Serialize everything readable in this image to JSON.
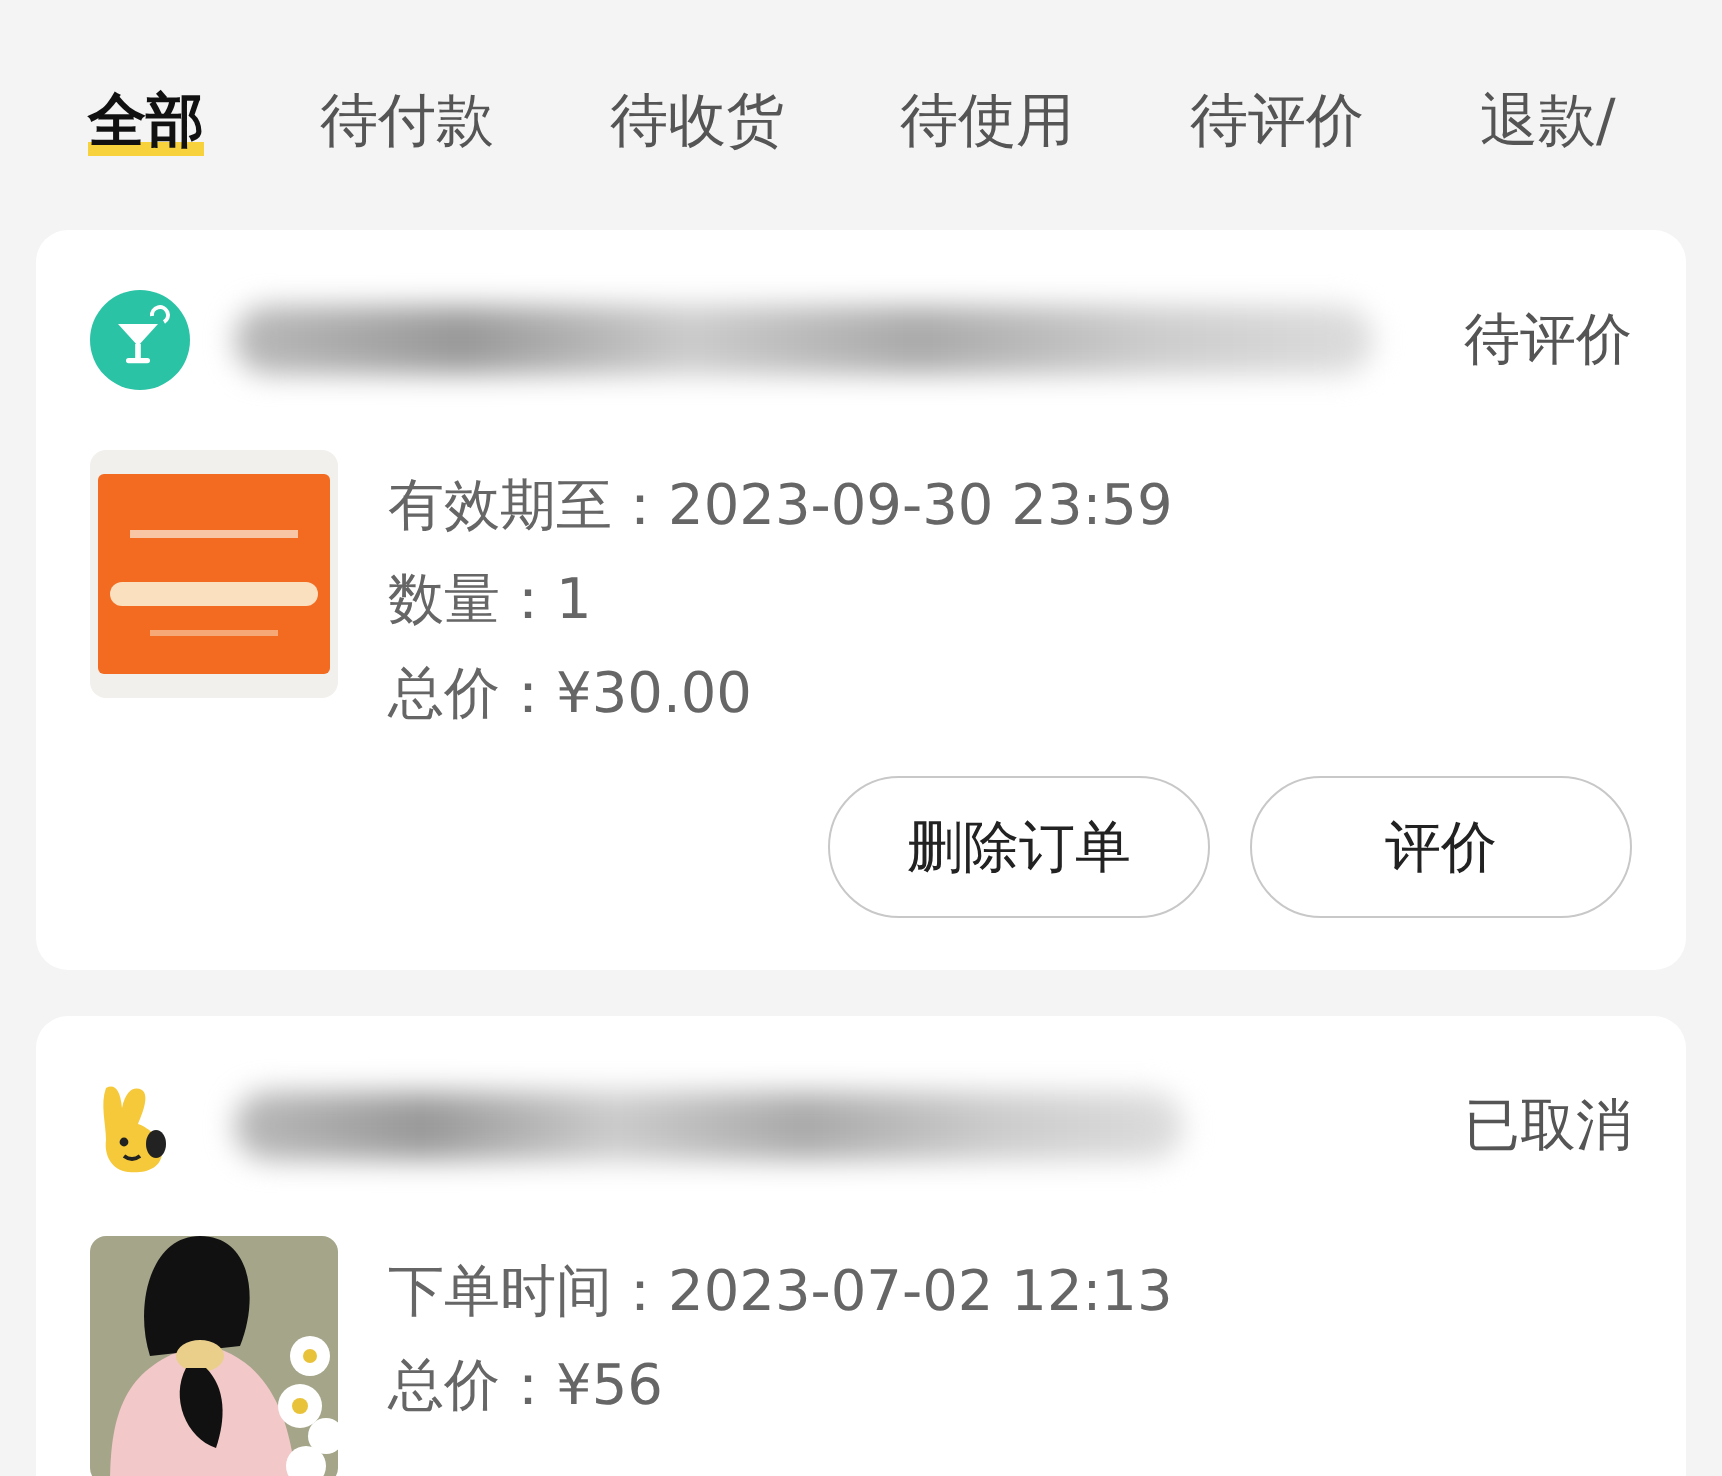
{
  "tabs": [
    {
      "label": "全部",
      "selected": true
    },
    {
      "label": "待付款",
      "selected": false
    },
    {
      "label": "待收货",
      "selected": false
    },
    {
      "label": "待使用",
      "selected": false
    },
    {
      "label": "待评价",
      "selected": false
    },
    {
      "label": "退款/",
      "selected": false
    }
  ],
  "orders": [
    {
      "kind": "cup",
      "status": "待评价",
      "thumbnail": {
        "kind": "picture"
      },
      "details": [
        "有效期至：2023-09-30 23:59",
        "数量：1",
        "总价：¥30.00"
      ],
      "buttons": [
        "删除订单",
        "评价"
      ]
    },
    {
      "kind": "rabbit",
      "status": "已取消",
      "thumbnail": {
        "kind": "picture"
      },
      "details": [
        "下单时间：2023-07-02 12:13",
        "总价：¥56"
      ]
    }
  ]
}
